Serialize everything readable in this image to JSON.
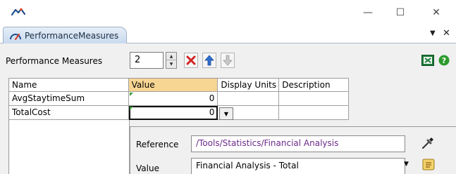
{
  "window": {
    "logo_icon": "flexsim-logo-icon",
    "controls": {
      "minimize": "—",
      "maximize": "☐",
      "close": "✕"
    }
  },
  "tab": {
    "label": "PerformanceMeasures",
    "icon": "gauge-icon",
    "menu_glyph": "▼",
    "close_glyph": "✕"
  },
  "toolbar": {
    "label": "Performance Measures",
    "count": "2",
    "buttons": [
      "delete-icon",
      "move-up-icon",
      "move-down-icon"
    ],
    "export_icon": "excel-icon",
    "help_icon": "help-icon"
  },
  "grid": {
    "columns": [
      "Name",
      "Value",
      "Display Units",
      "Description"
    ],
    "selected_column": "Value",
    "rows": [
      {
        "name": "AvgStaytimeSum",
        "value": "0",
        "units": "",
        "description": ""
      },
      {
        "name": "TotalCost",
        "value": "0",
        "units": "",
        "description": ""
      }
    ]
  },
  "popup": {
    "reference_label": "Reference",
    "reference_value": "/Tools/Statistics/Financial Analysis",
    "value_label": "Value",
    "value_selected": "Financial Analysis - Total"
  },
  "colors": {
    "header_selected": "#f7d592",
    "reference_text": "#6b2a8a",
    "tab_bg": "#c9daee"
  }
}
